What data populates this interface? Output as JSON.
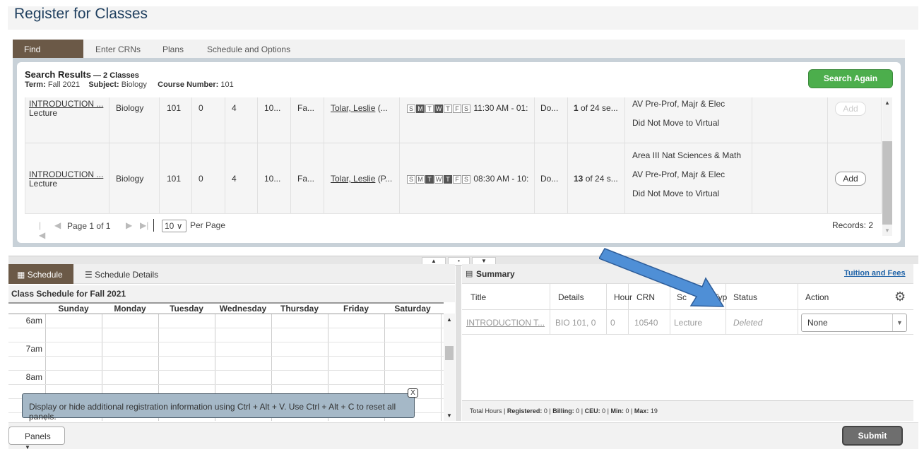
{
  "page": {
    "title": "Register for Classes"
  },
  "tabs": [
    "Find Classes",
    "Enter CRNs",
    "Plans",
    "Schedule and Options"
  ],
  "search": {
    "title": "Search Results",
    "count": " — 2 Classes",
    "term_label": "Term:",
    "term": "Fall 2021",
    "subject_label": "Subject:",
    "subject": "Biology",
    "course_label": "Course Number:",
    "course": "101",
    "again_button": "Search Again"
  },
  "results": [
    {
      "title": "INTRODUCTION ...",
      "type": "Lecture",
      "subject": "Biology",
      "course": "101",
      "section": "0",
      "hours": "4",
      "crn": "10...",
      "term": "Fa...",
      "instructor": "Tolar, Leslie",
      "instructor_extra": " (...",
      "days": [
        {
          "d": "S",
          "on": false
        },
        {
          "d": "M",
          "on": true
        },
        {
          "d": "T",
          "on": false
        },
        {
          "d": "W",
          "on": true
        },
        {
          "d": "T",
          "on": false
        },
        {
          "d": "F",
          "on": false
        },
        {
          "d": "S",
          "on": false
        }
      ],
      "time": "11:30 AM - 01:",
      "campus": "Do...",
      "status_num": "1",
      "status_text": " of 24 se...",
      "attributes": [
        "AV Pre-Prof, Majr & Elec",
        "Did Not Move to Virtual"
      ],
      "add": "Add",
      "add_disabled": true
    },
    {
      "title": "INTRODUCTION ...",
      "type": "Lecture",
      "subject": "Biology",
      "course": "101",
      "section": "0",
      "hours": "4",
      "crn": "10...",
      "term": "Fa...",
      "instructor": "Tolar, Leslie",
      "instructor_extra": " (P...",
      "days": [
        {
          "d": "S",
          "on": false
        },
        {
          "d": "M",
          "on": false
        },
        {
          "d": "T",
          "on": true
        },
        {
          "d": "W",
          "on": false
        },
        {
          "d": "T",
          "on": true
        },
        {
          "d": "F",
          "on": false
        },
        {
          "d": "S",
          "on": false
        }
      ],
      "time": "08:30 AM - 10:",
      "campus": "Do...",
      "status_num": "13",
      "status_text": " of 24 s...",
      "attributes": [
        "Area III Nat Sciences & Math",
        "AV Pre-Prof, Majr & Elec",
        "Did Not Move to Virtual"
      ],
      "add": "Add",
      "add_disabled": false
    }
  ],
  "pager": {
    "page_label": "Page",
    "page": "1",
    "of_label": "of",
    "total": "1",
    "per_page": "10",
    "per_page_label": "Per Page",
    "records": "Records: 2"
  },
  "schedule": {
    "tab_schedule": "Schedule",
    "tab_details": "Schedule Details",
    "subtitle": "Class Schedule for Fall 2021",
    "days": [
      "Sunday",
      "Monday",
      "Tuesday",
      "Wednesday",
      "Thursday",
      "Friday",
      "Saturday"
    ],
    "times": [
      "6am",
      "7am",
      "8am"
    ],
    "tooltip": "Display or hide additional registration information using Ctrl + Alt + V. Use Ctrl + Alt + C to reset all panels.",
    "tooltip_close": "X"
  },
  "summary": {
    "title": "Summary",
    "tuition_link": "Tuition and Fees",
    "columns": [
      "Title",
      "Details",
      "Hour",
      "CRN",
      "Sc",
      "Typ",
      "Status",
      "Action"
    ],
    "row": {
      "title": "INTRODUCTION T...",
      "details": "BIO 101, 0",
      "hours": "0",
      "crn": "10540",
      "schedule_type": "Lecture",
      "status": "Deleted",
      "action": "None"
    },
    "footer": {
      "total_hours": "Total Hours",
      "registered_label": "Registered:",
      "registered": "0",
      "billing_label": "Billing:",
      "billing": "0",
      "ceu_label": "CEU:",
      "ceu": "0",
      "min_label": "Min:",
      "min": "0",
      "max_label": "Max:",
      "max": "19"
    }
  },
  "bottom": {
    "panels": "Panels",
    "submit": "Submit"
  },
  "colors": {
    "accent_tab": "#6b5947",
    "search_again": "#4cae4c",
    "link_blue": "#1f63a8",
    "arrow": "#4f8fd6"
  }
}
